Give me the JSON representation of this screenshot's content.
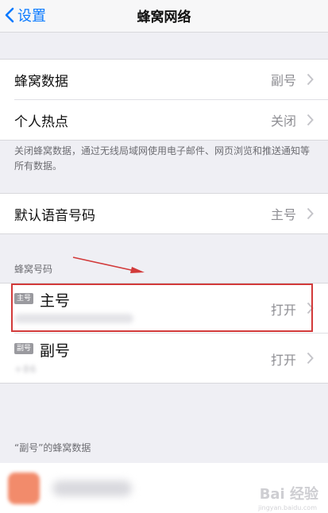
{
  "nav": {
    "back_label": "设置",
    "title": "蜂窝网络"
  },
  "group1": {
    "rows": [
      {
        "label": "蜂窝数据",
        "value": "副号"
      },
      {
        "label": "个人热点",
        "value": "关闭"
      }
    ]
  },
  "footnote1": "关闭蜂窝数据，通过无线局域网使用电子邮件、网页浏览和推送通知等所有数据。",
  "group2": {
    "label": "默认语音号码",
    "value": "主号"
  },
  "cellular_numbers": {
    "header": "蜂窝号码",
    "items": [
      {
        "badge": "主号",
        "name": "主号",
        "value": "打开",
        "sub": ""
      },
      {
        "badge": "副号",
        "name": "副号",
        "value": "打开",
        "sub": "+86"
      }
    ]
  },
  "data_section": {
    "header": "“副号”的蜂窝数据"
  },
  "watermark": {
    "main": "Bai 经验",
    "sub": "jingyan.baidu.com"
  },
  "colors": {
    "accent": "#0a7aff",
    "highlight": "#d23a3a",
    "background": "#efeff4"
  },
  "icons": {
    "back": "chevron-left-icon",
    "disclosure": "chevron-right-icon",
    "arrow": "annotation-arrow-icon"
  }
}
